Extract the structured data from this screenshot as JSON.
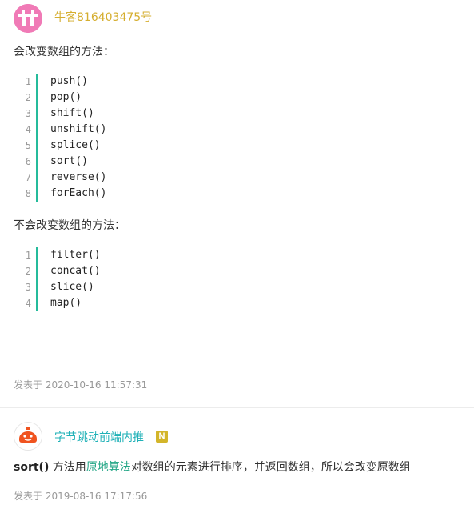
{
  "post1": {
    "username": "牛客816403475号",
    "intro_mutating": "会改变数组的方法：",
    "mutating_methods": [
      {
        "num": "1",
        "code": "push()"
      },
      {
        "num": "2",
        "code": "pop()"
      },
      {
        "num": "3",
        "code": "shift()"
      },
      {
        "num": "4",
        "code": "unshift()"
      },
      {
        "num": "5",
        "code": "splice()"
      },
      {
        "num": "6",
        "code": "sort()"
      },
      {
        "num": "7",
        "code": "reverse()"
      },
      {
        "num": "8",
        "code": "forEach()"
      }
    ],
    "intro_non_mutating": "不会改变数组的方法：",
    "non_mutating_methods": [
      {
        "num": "1",
        "code": "filter()"
      },
      {
        "num": "2",
        "code": "concat()"
      },
      {
        "num": "3",
        "code": "slice()"
      },
      {
        "num": "4",
        "code": "map()"
      }
    ],
    "time": "发表于 2020-10-16 11:57:31"
  },
  "post2": {
    "username": "字节跳动前端内推",
    "badge": "N",
    "comment_bold": "sort()",
    "comment_part1": " 方法用",
    "comment_link": "原地算法",
    "comment_part2": "对数组的元素进行排序，并返回数组，所以会改变原数组",
    "time": "发表于 2019-08-16 17:17:56"
  },
  "colors": {
    "username1": "#d5ae2f",
    "username2": "#1fb1b7",
    "code_bar": "#25bb9b",
    "link": "#23a686",
    "badge": "#d3b52a"
  }
}
